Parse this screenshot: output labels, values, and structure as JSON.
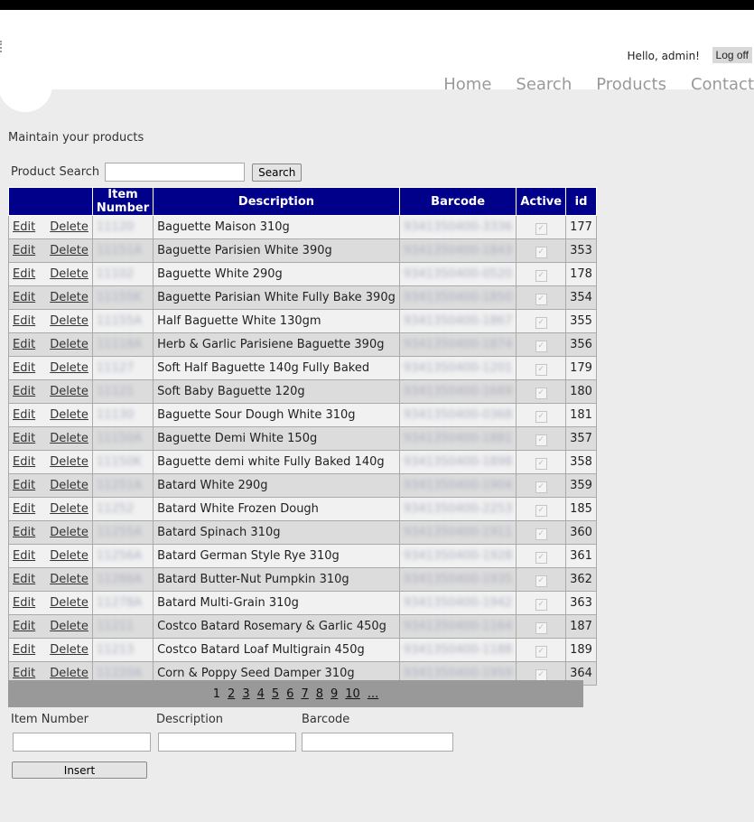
{
  "header": {
    "greeting": "Hello, admin!",
    "logoff": "Log off",
    "nav": [
      "Home",
      "Search",
      "Products",
      "Contact"
    ]
  },
  "page": {
    "intro": "Maintain your products"
  },
  "search": {
    "label": "Product Search",
    "value": "",
    "button": "Search"
  },
  "table": {
    "headers": [
      "",
      "Item Number",
      "Description",
      "Barcode",
      "Active",
      "id"
    ],
    "edit_label": "Edit",
    "delete_label": "Delete",
    "rows": [
      {
        "item": "11120",
        "desc": "Baguette Maison 310g",
        "barcode": "9341350400-3336",
        "active": true,
        "id": "177"
      },
      {
        "item": "11151A",
        "desc": "Baguette Parisien White 390g",
        "barcode": "9341350400-1843",
        "active": true,
        "id": "353"
      },
      {
        "item": "11102",
        "desc": "Baguette White 290g",
        "barcode": "9341350400-0520",
        "active": true,
        "id": "178"
      },
      {
        "item": "11155K",
        "desc": "Baguette Parisian White Fully Bake 390g",
        "barcode": "9341350400-1850",
        "active": true,
        "id": "354"
      },
      {
        "item": "11155A",
        "desc": "Half Baguette White 130gm",
        "barcode": "9341350400-1867",
        "active": true,
        "id": "355"
      },
      {
        "item": "11118A",
        "desc": "Herb & Garlic Parisiene Baguette 390g",
        "barcode": "9341350400-1874",
        "active": true,
        "id": "356"
      },
      {
        "item": "11127",
        "desc": "Soft Half Baguette 140g Fully Baked",
        "barcode": "9341350400-1201",
        "active": true,
        "id": "179"
      },
      {
        "item": "11121",
        "desc": "Soft Baby Baguette 120g",
        "barcode": "9341350400-1669",
        "active": true,
        "id": "180"
      },
      {
        "item": "11130",
        "desc": "Baguette Sour Dough White 310g",
        "barcode": "9341350400-0368",
        "active": true,
        "id": "181"
      },
      {
        "item": "11150A",
        "desc": "Baguette Demi White 150g",
        "barcode": "9341350400-1881",
        "active": true,
        "id": "357"
      },
      {
        "item": "11150K",
        "desc": "Baguette demi white Fully Baked 140g",
        "barcode": "9341350400-1898",
        "active": true,
        "id": "358"
      },
      {
        "item": "11251A",
        "desc": "Batard White 290g",
        "barcode": "9341350400-1904",
        "active": true,
        "id": "359"
      },
      {
        "item": "11252",
        "desc": "Batard White Frozen Dough",
        "barcode": "9341350400-2253",
        "active": true,
        "id": "185"
      },
      {
        "item": "11255A",
        "desc": "Batard Spinach 310g",
        "barcode": "9341350400-1911",
        "active": true,
        "id": "360"
      },
      {
        "item": "11256A",
        "desc": "Batard German Style Rye 310g",
        "barcode": "9341350400-1928",
        "active": true,
        "id": "361"
      },
      {
        "item": "11266A",
        "desc": "Batard Butter-Nut Pumpkin 310g",
        "barcode": "9341350400-1935",
        "active": true,
        "id": "362"
      },
      {
        "item": "11278A",
        "desc": "Batard Multi-Grain 310g",
        "barcode": "9341350400-1942",
        "active": true,
        "id": "363"
      },
      {
        "item": "11211",
        "desc": "Costco Batard Rosemary & Garlic 450g",
        "barcode": "9341350400-1164",
        "active": true,
        "id": "187"
      },
      {
        "item": "11213",
        "desc": "Costco Batard Loaf Multigrain 450g",
        "barcode": "9341350400-1188",
        "active": true,
        "id": "189"
      },
      {
        "item": "11220A",
        "desc": "Corn & Poppy Seed Damper 310g",
        "barcode": "9341350400-1959",
        "active": true,
        "id": "364"
      }
    ]
  },
  "pager": {
    "current": "1",
    "pages": [
      "2",
      "3",
      "4",
      "5",
      "6",
      "7",
      "8",
      "9",
      "10",
      "..."
    ]
  },
  "insert": {
    "item_label": "Item Number",
    "desc_label": "Description",
    "barcode_label": "Barcode",
    "button": "Insert"
  },
  "colors": {
    "header_bg": "#00008b",
    "row_odd": "#f1f1f1",
    "row_even": "#dcdcdc",
    "pager_bg": "#999999"
  }
}
